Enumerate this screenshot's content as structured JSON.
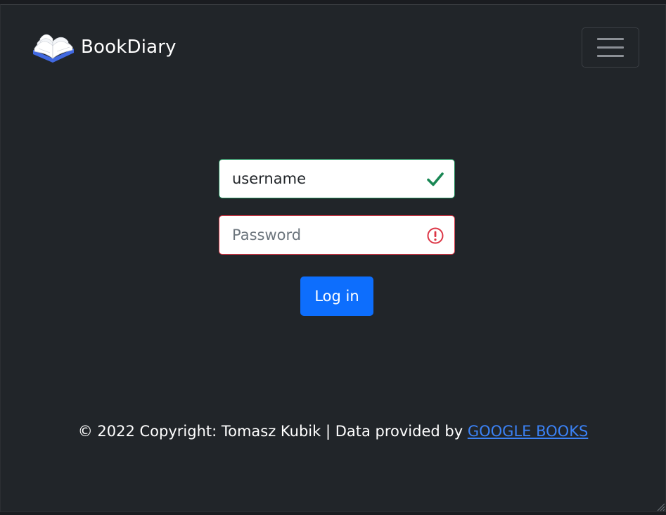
{
  "navbar": {
    "brand_name": "BookDiary",
    "logo_icon": "open-book-icon",
    "toggler_icon": "hamburger-menu-icon"
  },
  "login_form": {
    "username": {
      "value": "username",
      "placeholder": "Username",
      "state": "valid",
      "state_icon": "checkmark-icon"
    },
    "password": {
      "value": "",
      "placeholder": "Password",
      "state": "invalid",
      "state_icon": "exclamation-circle-icon"
    },
    "submit_label": "Log in"
  },
  "footer": {
    "text": "© 2022 Copyright: Tomasz Kubik | Data provided by ",
    "link_text": "GOOGLE BOOKS"
  },
  "colors": {
    "background": "#212529",
    "primary": "#0d6efd",
    "valid": "#198754",
    "invalid": "#dc3545",
    "link": "#3b82f6"
  }
}
